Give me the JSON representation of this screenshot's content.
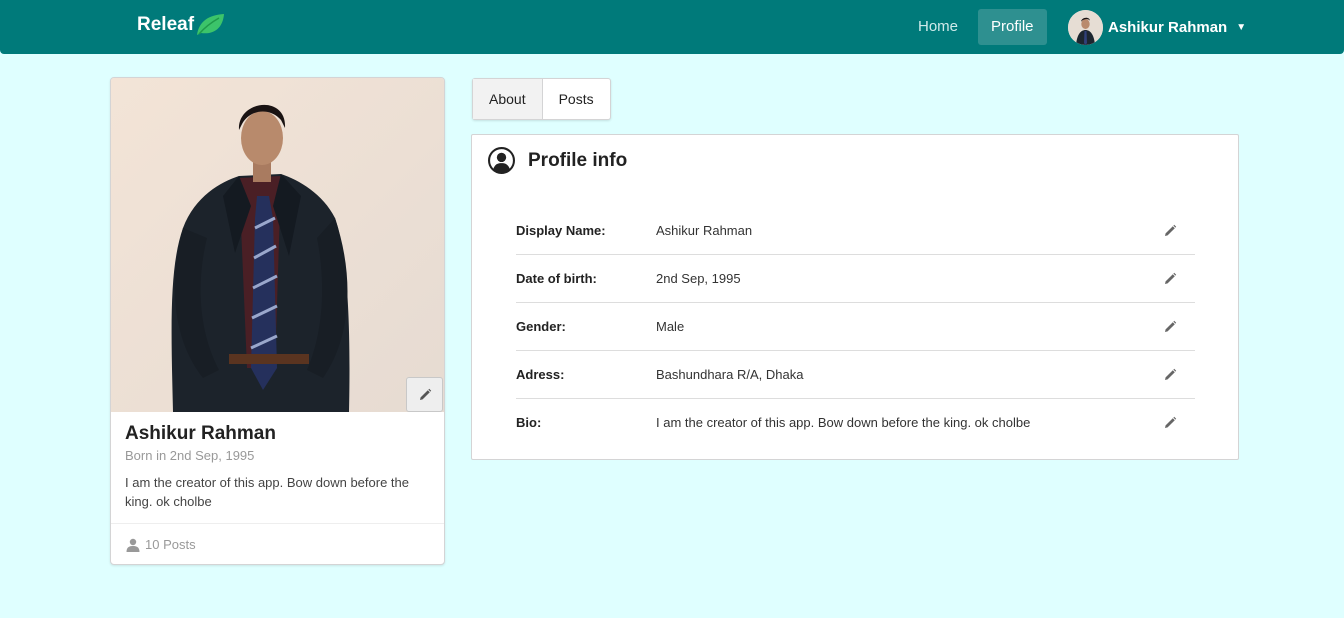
{
  "navbar": {
    "brand": "Releaf",
    "home": "Home",
    "profile": "Profile",
    "user_name": "Ashikur Rahman"
  },
  "profile_card": {
    "name": "Ashikur Rahman",
    "born": "Born in 2nd Sep, 1995",
    "bio": "I am the creator of this app. Bow down before the king. ok cholbe",
    "posts": "10 Posts"
  },
  "tabs": [
    {
      "label": "About",
      "active": true
    },
    {
      "label": "Posts",
      "active": false
    }
  ],
  "profile_info": {
    "title": "Profile info",
    "rows": [
      {
        "label": "Display Name:",
        "value": "Ashikur Rahman"
      },
      {
        "label": "Date of birth:",
        "value": "2nd Sep, 1995"
      },
      {
        "label": "Gender:",
        "value": "Male"
      },
      {
        "label": "Adress:",
        "value": "Bashundhara R/A, Dhaka"
      },
      {
        "label": "Bio:",
        "value": "I am the creator of this app. Bow down before the king. ok cholbe"
      }
    ]
  },
  "icons": {
    "brand": "leaf-icon",
    "caret": "caret-down-icon",
    "edit": "pencil-icon",
    "profile_info": "user-circle-icon",
    "posts": "user-icon"
  },
  "colors": {
    "navbar": "#007a7a",
    "page_background": "#dfffff",
    "leaf": "#3cc46a"
  }
}
